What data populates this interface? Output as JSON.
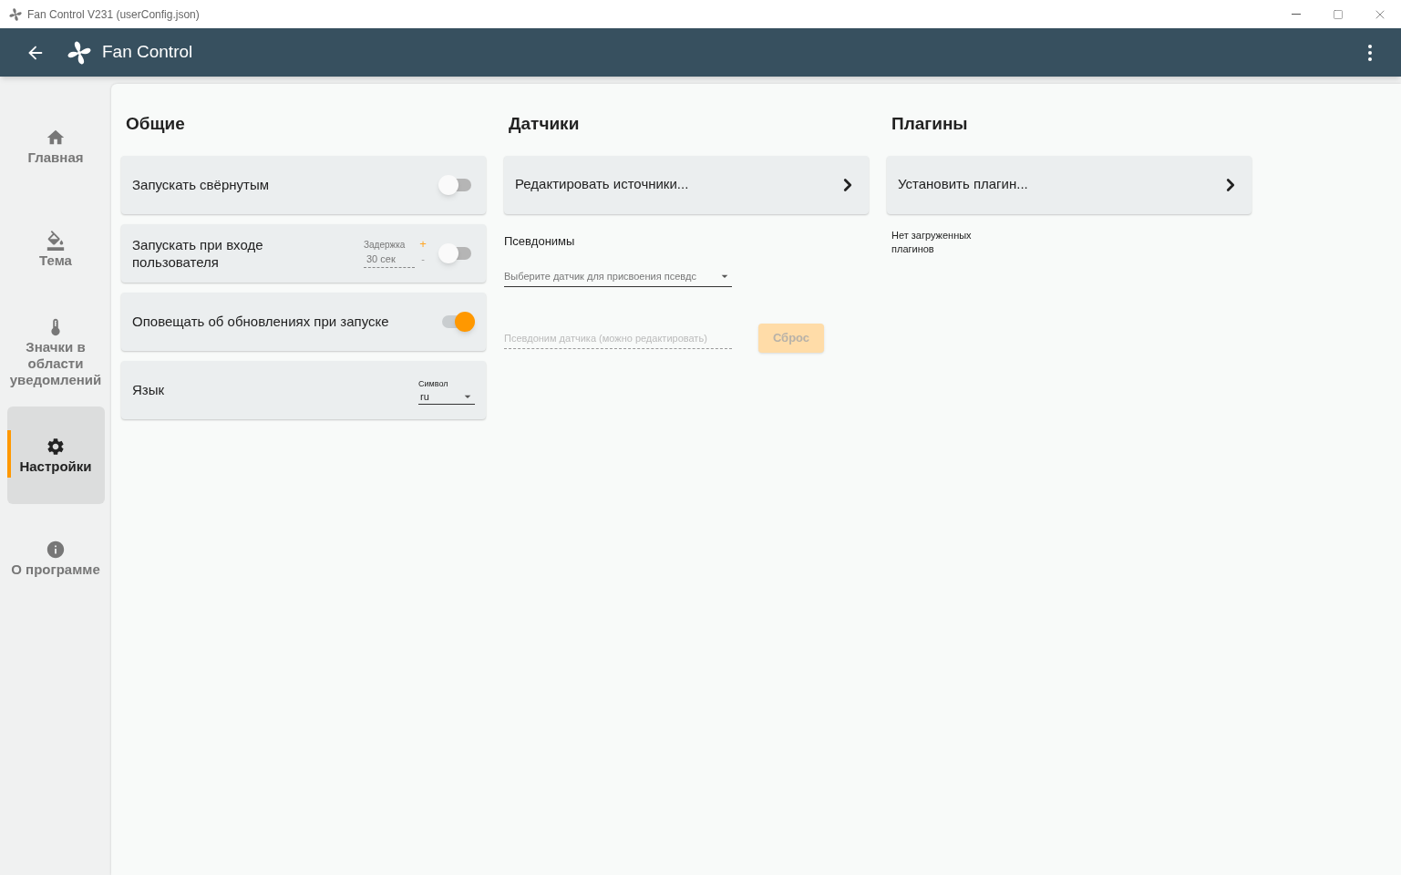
{
  "window": {
    "title": "Fan Control V231 (userConfig.json)"
  },
  "app_bar": {
    "title": "Fan Control"
  },
  "sidebar": {
    "items": [
      {
        "label": "Главная",
        "selected": false
      },
      {
        "label": "Тема",
        "selected": false
      },
      {
        "label": "Значки в области уведомлений",
        "selected": false
      },
      {
        "label": "Настройки",
        "selected": true
      },
      {
        "label": "О программе",
        "selected": false
      }
    ]
  },
  "general": {
    "title": "Общие",
    "rows": [
      {
        "kind": "toggle",
        "label": "Запускать свёрнутым",
        "on": false
      },
      {
        "kind": "toggle_delay",
        "label": "Запускать при входе пользователя",
        "on": false,
        "delay_label": "Задержка",
        "delay_value": "30 сек",
        "plus": "+",
        "minus": "-"
      },
      {
        "kind": "toggle",
        "label": "Оповещать об обновлениях при запуске",
        "on": true
      },
      {
        "kind": "select",
        "label": "Язык",
        "field_label": "Символ",
        "value": "ru"
      }
    ]
  },
  "sensors": {
    "title": "Датчики",
    "edit_sources": "Редактировать источники...",
    "aliases_title": "Псевдонимы",
    "sensor_select": {
      "placeholder": "Выберите датчик для присвоения псевдс"
    },
    "alias_field": {
      "placeholder": "Псевдоним датчика (можно редактировать)"
    },
    "reset_button": {
      "label": "Сброс",
      "disabled": true
    }
  },
  "plugins": {
    "title": "Плагины",
    "install": "Установить плагин...",
    "empty": "Нет загруженных плагинов"
  }
}
